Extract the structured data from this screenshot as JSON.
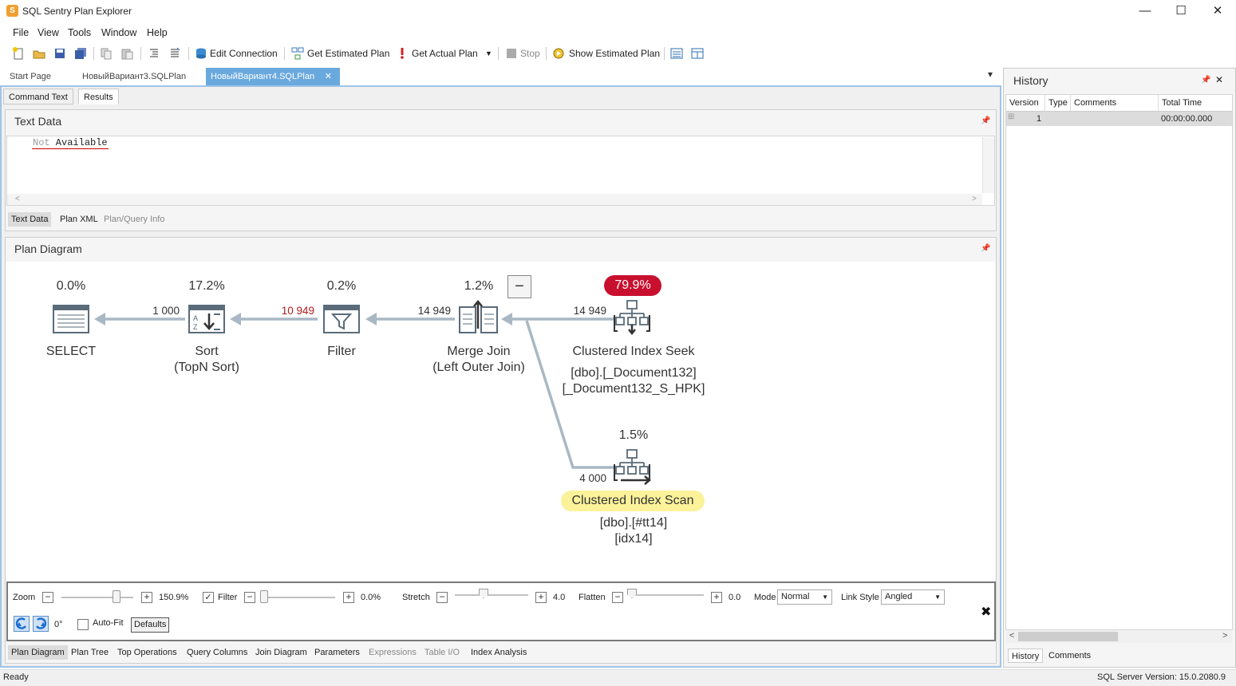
{
  "window": {
    "title": "SQL Sentry Plan Explorer",
    "minimize": "—",
    "maximize": "☐",
    "close": "✕"
  },
  "menu": [
    "File",
    "View",
    "Tools",
    "Window",
    "Help"
  ],
  "toolbar": {
    "edit_connection": "Edit Connection",
    "get_estimated_plan": "Get Estimated Plan",
    "get_actual_plan": "Get Actual Plan",
    "stop": "Stop",
    "show_estimated_plan": "Show Estimated Plan"
  },
  "doc_tabs": [
    {
      "label": "Start Page",
      "active": false
    },
    {
      "label": "НовыйВариант3.SQLPlan",
      "active": false
    },
    {
      "label": "НовыйВариант4.SQLPlan",
      "active": true
    }
  ],
  "doc_tab_close": "✕",
  "doc_dropdown": "▾",
  "sub_tabs": {
    "command_text": "Command Text",
    "results": "Results"
  },
  "text_data": {
    "title": "Text Data",
    "content_part1": "Not",
    "content_part2": " Available",
    "tabs": {
      "text_data": "Text Data",
      "plan_xml": "Plan XML",
      "plan_query_info": "Plan/Query Info"
    }
  },
  "plan_diagram": {
    "title": "Plan Diagram",
    "collapse_btn": "−",
    "nodes": {
      "select": {
        "pct": "0.0%",
        "label": "SELECT"
      },
      "sort": {
        "pct": "17.2%",
        "label1": "Sort",
        "label2": "(TopN Sort)"
      },
      "filter": {
        "pct": "0.2%",
        "label": "Filter"
      },
      "merge": {
        "pct": "1.2%",
        "label1": "Merge Join",
        "label2": "(Left Outer Join)"
      },
      "seek": {
        "pct": "79.9%",
        "label": "Clustered Index Seek",
        "obj1": "[dbo].[_Document132]",
        "obj2": "[_Document132_S_HPK]"
      },
      "scan": {
        "pct": "1.5%",
        "label": "Clustered Index Scan",
        "obj1": "[dbo].[#tt14]",
        "obj2": "[idx14]"
      }
    },
    "edges": {
      "sort_to_select": "1 000",
      "filter_to_sort": "10 949",
      "merge_to_filter": "14 949",
      "seek_to_merge": "14 949",
      "scan_to_merge": "4 000"
    },
    "colors": {
      "hot": "#c8102e",
      "highlight": "#fbf29a",
      "edge": "#a9b8c4",
      "warn_count": "#b01c1c"
    }
  },
  "controls": {
    "zoom_label": "Zoom",
    "zoom_value": "150.9%",
    "filter_label": "Filter",
    "filter_value": "0.0%",
    "filter_checked": true,
    "stretch_label": "Stretch",
    "stretch_value": "4.0",
    "flatten_label": "Flatten",
    "flatten_value": "0.0",
    "mode_label": "Mode",
    "mode_value": "Normal",
    "link_style_label": "Link Style",
    "link_style_value": "Angled",
    "rotation_value": "0°",
    "autofit_label": "Auto-Fit",
    "defaults_label": "Defaults",
    "close": "✖"
  },
  "bottom_tabs": [
    {
      "label": "Plan Diagram",
      "state": "active"
    },
    {
      "label": "Plan Tree",
      "state": "normal"
    },
    {
      "label": "Top Operations",
      "state": "normal"
    },
    {
      "label": "Query Columns",
      "state": "normal"
    },
    {
      "label": "Join Diagram",
      "state": "normal"
    },
    {
      "label": "Parameters",
      "state": "normal"
    },
    {
      "label": "Expressions",
      "state": "disabled"
    },
    {
      "label": "Table I/O",
      "state": "disabled"
    },
    {
      "label": "Index Analysis",
      "state": "normal"
    }
  ],
  "history": {
    "title": "History",
    "columns": [
      "Version",
      "Type",
      "Comments",
      "Total Time"
    ],
    "rows": [
      {
        "version": "1",
        "type": "",
        "comments": "",
        "total_time": "00:00:00.000"
      }
    ],
    "tabs": {
      "history": "History",
      "comments": "Comments"
    }
  },
  "status": {
    "left": "Ready",
    "right": "SQL Server Version: 15.0.2080.9"
  }
}
